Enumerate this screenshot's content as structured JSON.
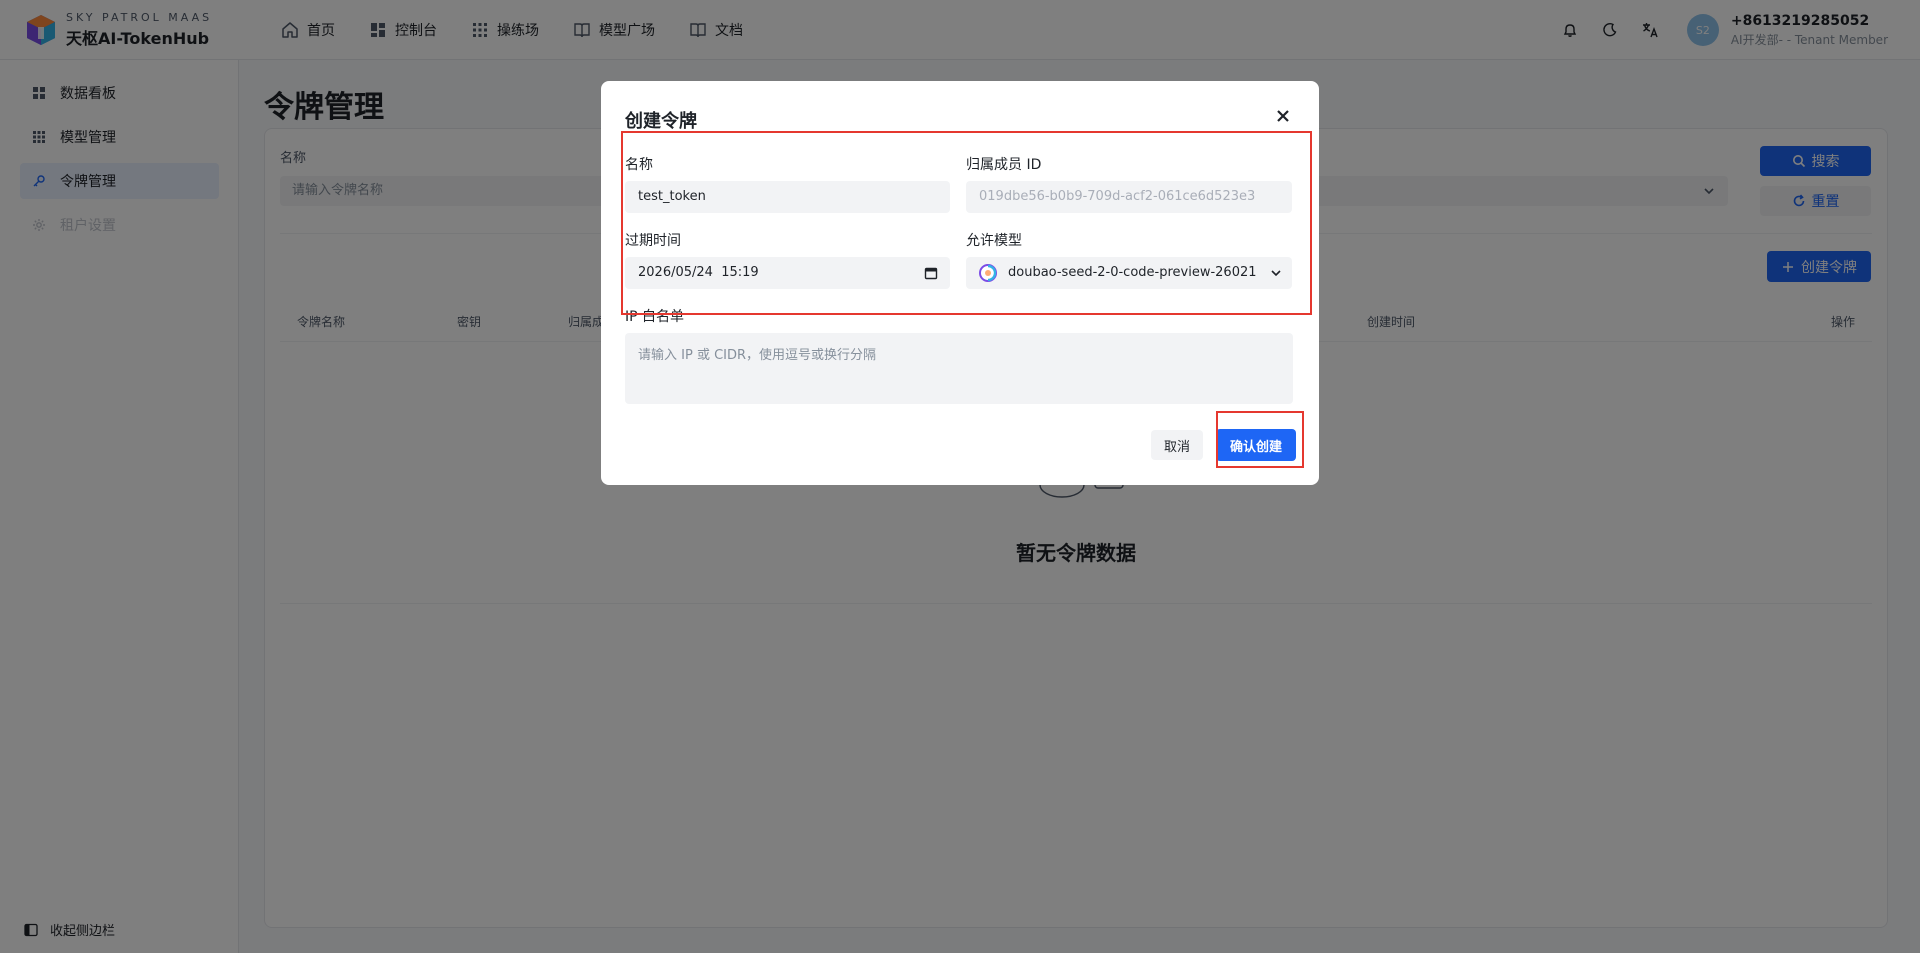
{
  "header": {
    "brand_top": "SKY PATROL MAAS",
    "brand_name": "天枢AI-TokenHub",
    "nav": [
      {
        "label": "首页",
        "icon": "home-icon"
      },
      {
        "label": "控制台",
        "icon": "dashboard-icon"
      },
      {
        "label": "操练场",
        "icon": "grid-icon"
      },
      {
        "label": "模型广场",
        "icon": "book-open-icon"
      },
      {
        "label": "文档",
        "icon": "book-icon"
      }
    ],
    "user": {
      "avatar_text": "S2",
      "phone": "+8613219285052",
      "role": "AI开发部- - Tenant Member"
    }
  },
  "sidebar": {
    "items": [
      {
        "label": "数据看板",
        "icon": "dashboard-icon",
        "state": "normal"
      },
      {
        "label": "模型管理",
        "icon": "grid-icon",
        "state": "normal"
      },
      {
        "label": "令牌管理",
        "icon": "key-icon",
        "state": "active"
      },
      {
        "label": "租户设置",
        "icon": "gear-icon",
        "state": "disabled"
      }
    ],
    "collapse_label": "收起侧边栏"
  },
  "main": {
    "title": "令牌管理",
    "filter": {
      "label": "名称",
      "placeholder": "请输入令牌名称"
    },
    "search_label": "搜索",
    "reset_label": "重置",
    "create_label": "创建令牌",
    "table_headers": [
      "令牌名称",
      "密钥",
      "归属成",
      "创建时间",
      "操作"
    ],
    "empty_text": "暂无令牌数据"
  },
  "modal": {
    "title": "创建令牌",
    "name_label": "名称",
    "name_value": "test_token",
    "member_label": "归属成员 ID",
    "member_value": "019dbe56-b0b9-709d-acf2-061ce6d523e3",
    "expire_label": "过期时间",
    "expire_value": "2026/05/24  15:19",
    "model_label": "允许模型",
    "model_value": "doubao-seed-2-0-code-preview-26021",
    "ip_label": "IP 白名单",
    "ip_placeholder": "请输入 IP 或 CIDR，使用逗号或换行分隔",
    "cancel_label": "取消",
    "confirm_label": "确认创建"
  },
  "colors": {
    "primary": "#1e66f5",
    "annotation": "#e5382f"
  }
}
